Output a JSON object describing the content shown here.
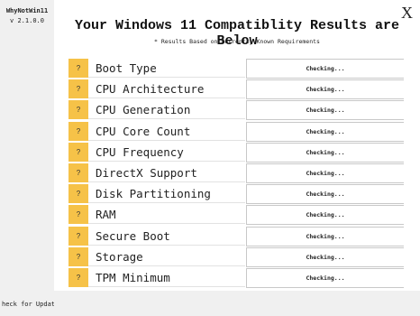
{
  "sidebar": {
    "app_name": "WhyNotWin11",
    "version": "v 2.1.0.0",
    "update_link": "heck for Update"
  },
  "header": {
    "close_label": "X",
    "title": "Your Windows 11 Compatiblity Results are Below",
    "subtitle": "* Results Based on Currently Known Requirements"
  },
  "checks": [
    {
      "badge": "?",
      "label": "Boot Type",
      "status": "Checking..."
    },
    {
      "badge": "?",
      "label": "CPU Architecture",
      "status": "Checking..."
    },
    {
      "badge": "?",
      "label": "CPU Generation",
      "status": "Checking..."
    },
    {
      "badge": "?",
      "label": "CPU Core Count",
      "status": "Checking..."
    },
    {
      "badge": "?",
      "label": "CPU Frequency",
      "status": "Checking..."
    },
    {
      "badge": "?",
      "label": "DirectX Support",
      "status": "Checking..."
    },
    {
      "badge": "?",
      "label": "Disk Partitioning",
      "status": "Checking..."
    },
    {
      "badge": "?",
      "label": "RAM",
      "status": "Checking..."
    },
    {
      "badge": "?",
      "label": "Secure Boot",
      "status": "Checking..."
    },
    {
      "badge": "?",
      "label": "Storage",
      "status": "Checking..."
    },
    {
      "badge": "?",
      "label": "TPM Minimum",
      "status": "Checking..."
    }
  ],
  "colors": {
    "badge_unknown": "#f6c248",
    "sidebar_bg": "#f0f0f0"
  }
}
